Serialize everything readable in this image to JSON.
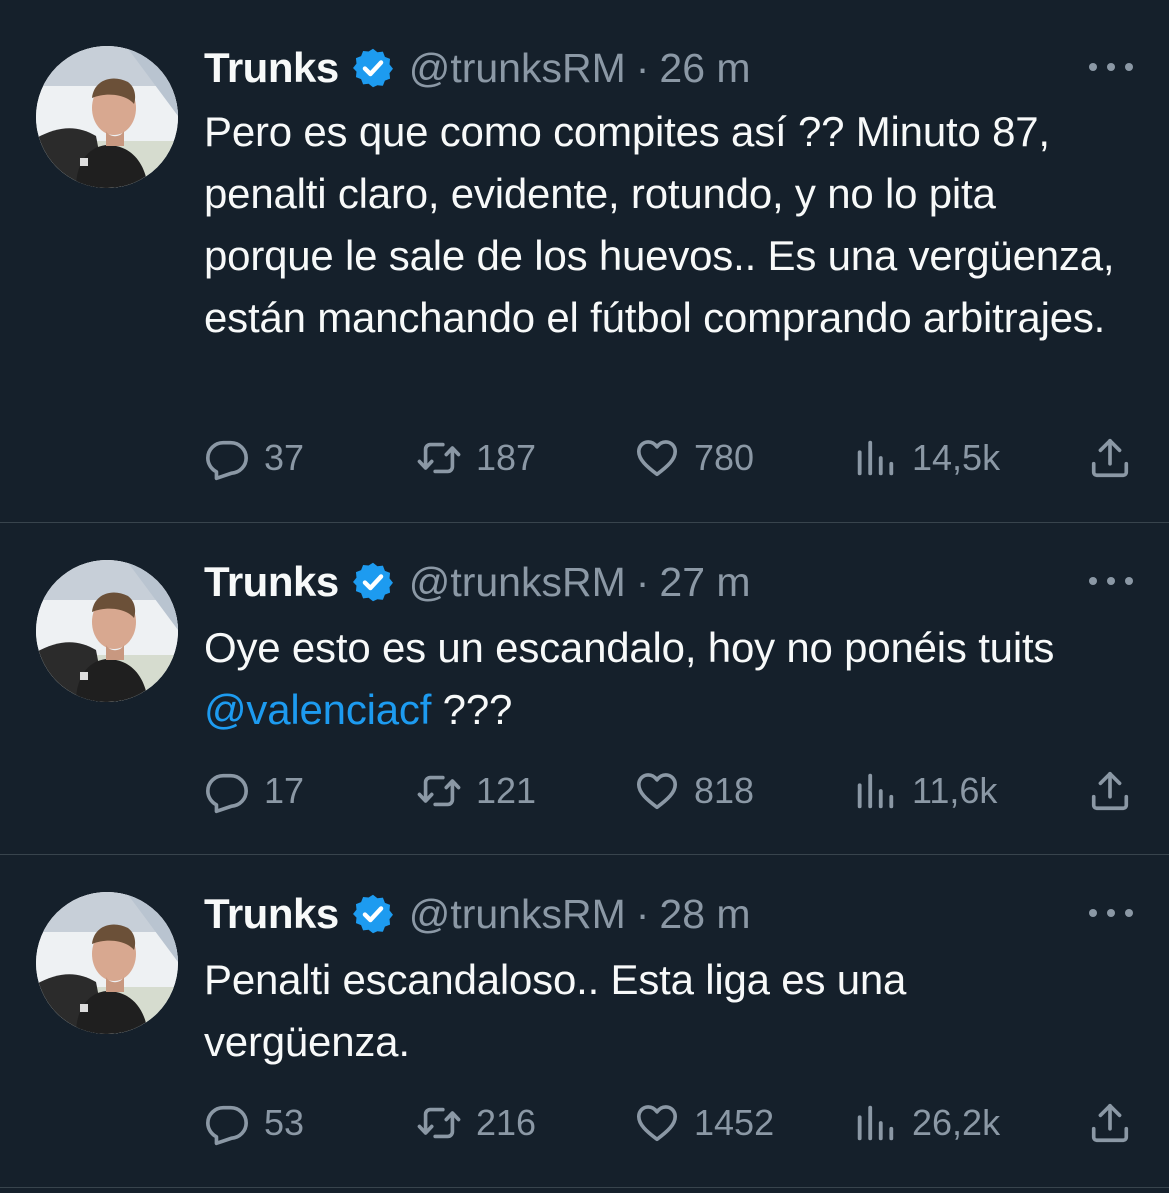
{
  "tweets": [
    {
      "name": "Trunks",
      "handle": "@trunksRM",
      "separator": "·",
      "time": "26 m",
      "text": "Pero es que como compites así ?? Minuto 87, penalti claro, evidente, rotundo, y no lo pita porque le sale de los huevos.. Es una vergüenza, están manchando el fútbol comprando arbitrajes.",
      "replies": "37",
      "retweets": "187",
      "likes": "780",
      "views": "14,5k"
    },
    {
      "name": "Trunks",
      "handle": "@trunksRM",
      "separator": "·",
      "time": "27 m",
      "text_before": "Oye esto es un escandalo, hoy no ponéis tuits ",
      "mention": "@valenciacf",
      "text_after": " ???",
      "replies": "17",
      "retweets": "121",
      "likes": "818",
      "views": "11,6k"
    },
    {
      "name": "Trunks",
      "handle": "@trunksRM",
      "separator": "·",
      "time": "28 m",
      "text": "Penalti escandaloso.. Esta liga es una vergüenza.",
      "replies": "53",
      "retweets": "216",
      "likes": "1452",
      "views": "26,2k"
    }
  ],
  "colors": {
    "background": "#15202b",
    "text": "#f7f9f9",
    "secondary": "#8b98a5",
    "accent": "#1d9bf0",
    "divider": "#38444d"
  },
  "icons": [
    "reply-icon",
    "retweet-icon",
    "like-icon",
    "views-icon",
    "share-icon",
    "verified-badge-icon",
    "more-icon"
  ]
}
